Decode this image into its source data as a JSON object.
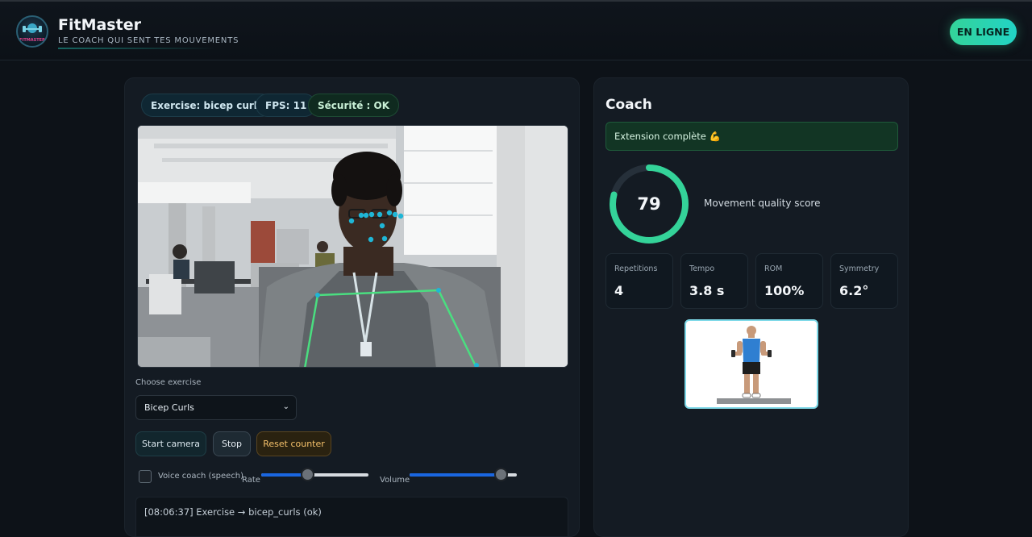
{
  "header": {
    "title": "FitMaster",
    "subtitle": "LE COACH QUI SENT TES MOUVEMENTS",
    "status": "EN LIGNE",
    "logo_text": "FITMASTER"
  },
  "left": {
    "chips": {
      "exercise": "Exercise: bicep curls",
      "fps": "FPS: 11",
      "safety": "Sécurité : OK"
    },
    "choose_label": "Choose exercise",
    "select_value": "Bicep Curls",
    "buttons": {
      "start": "Start camera",
      "stop": "Stop",
      "reset": "Reset counter"
    },
    "voice_label": "Voice coach (speech)",
    "rate_label": "Rate",
    "volume_label": "Volume",
    "rate_value": 0.43,
    "volume_value": 0.85,
    "log_line": "[08:06:37] Exercise → bicep_curls (ok)"
  },
  "coach": {
    "title": "Coach",
    "banner": "Extension complète 💪",
    "score": "79",
    "score_fraction": 0.79,
    "score_label": "Movement quality score",
    "stats": [
      {
        "label": "Repetitions",
        "value": "4"
      },
      {
        "label": "Tempo",
        "value": "3.8 s"
      },
      {
        "label": "ROM",
        "value": "100%"
      },
      {
        "label": "Symmetry",
        "value": "6.2°"
      }
    ]
  },
  "colors": {
    "accent": "#34d399",
    "gauge_track": "#26303a",
    "pose_skeleton": "#4ade80",
    "face_points": "#1fb6d6"
  }
}
